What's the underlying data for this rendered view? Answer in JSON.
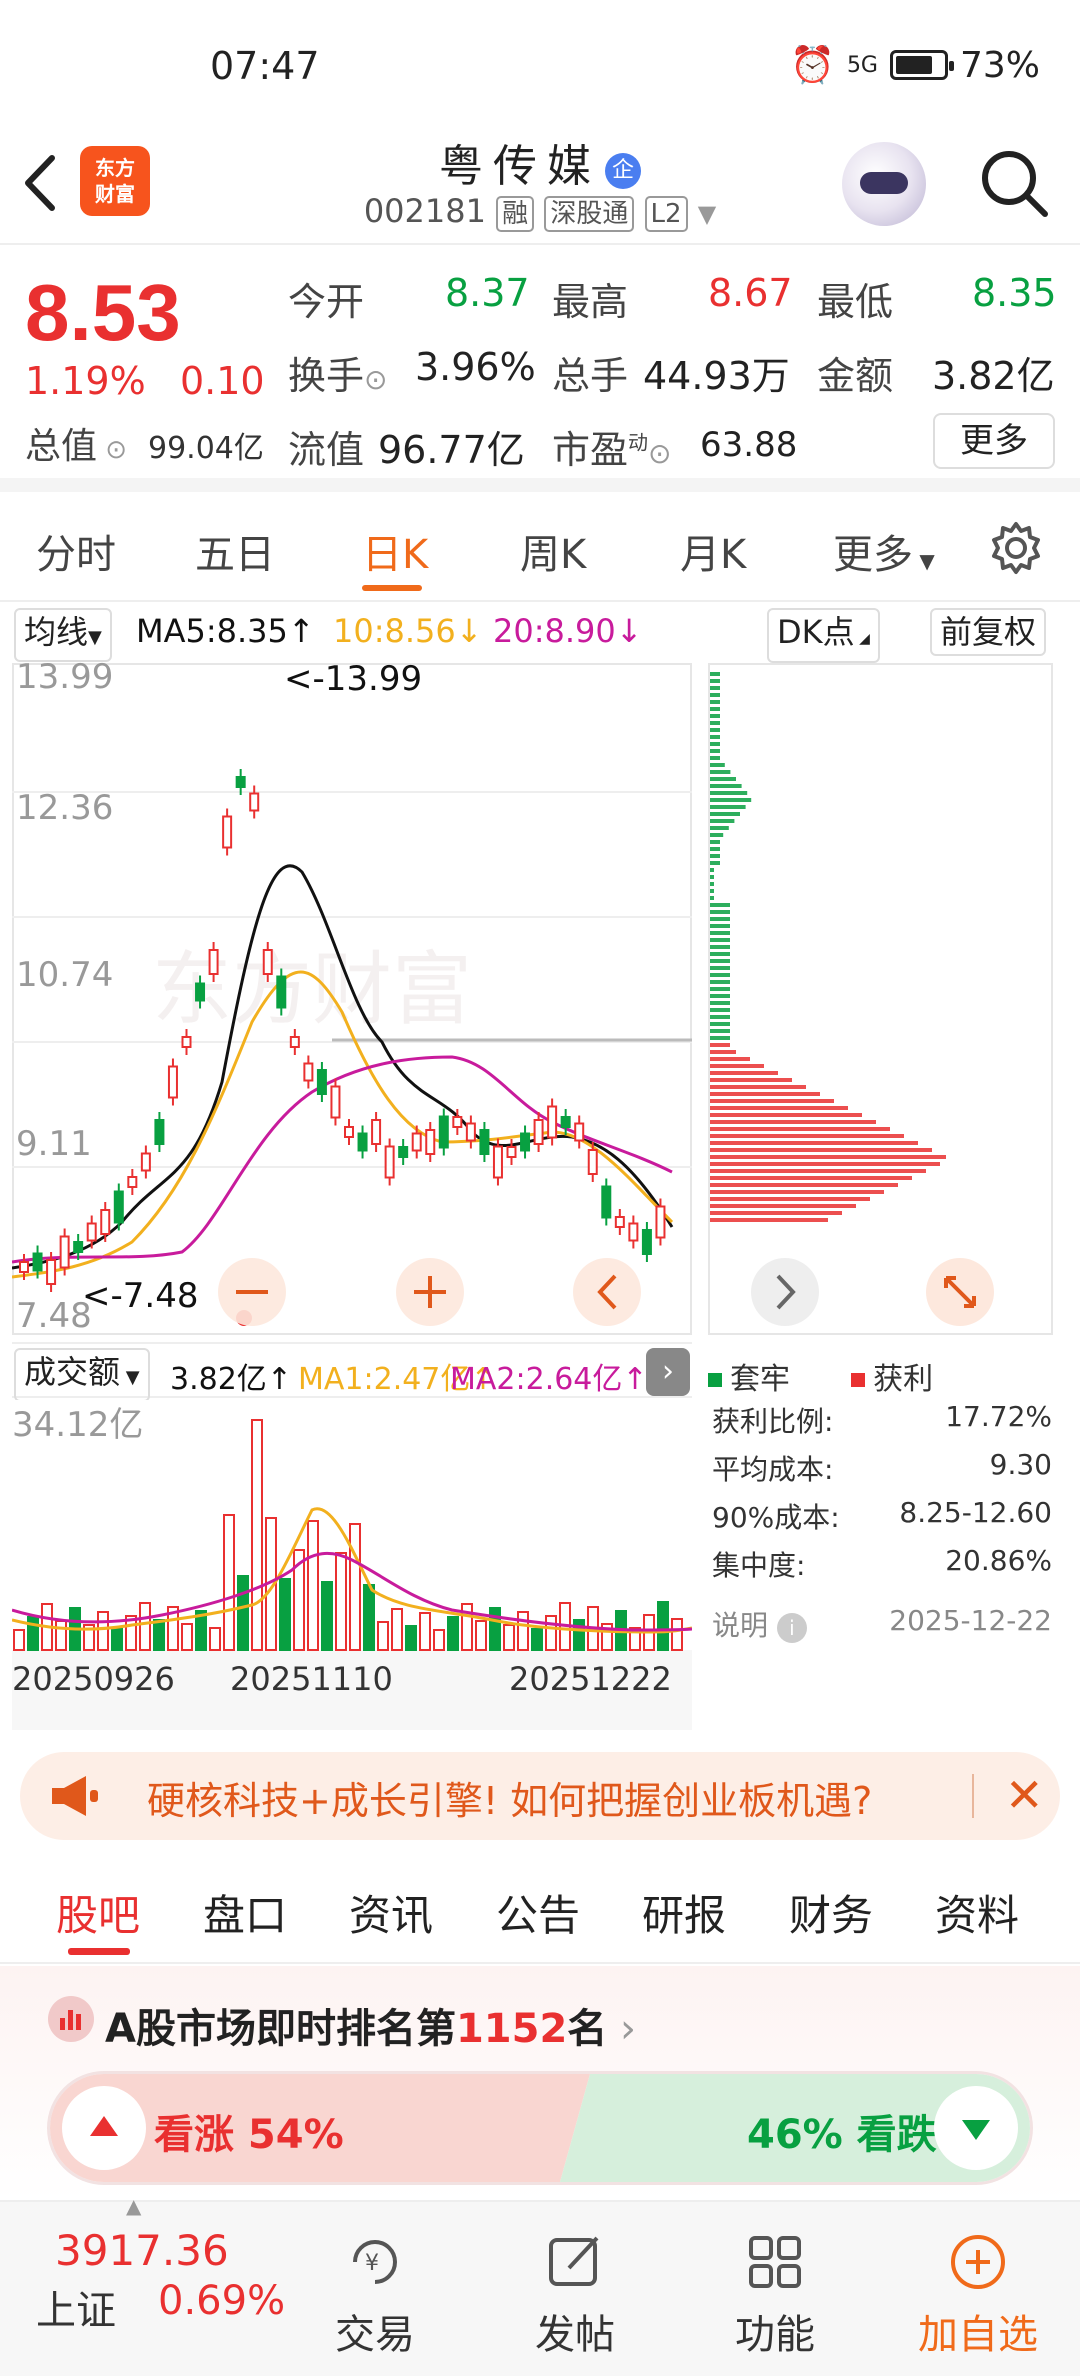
{
  "status_bar": {
    "time": "07:47",
    "network": "5G",
    "battery": "73%"
  },
  "header": {
    "logo_line1": "东方",
    "logo_line2": "财富",
    "stock_name": "粤传媒",
    "badge": "企",
    "code": "002181",
    "tags": [
      "融",
      "深股通",
      "L2"
    ]
  },
  "quote": {
    "price": "8.53",
    "change_pct": "1.19%",
    "change": "0.10",
    "open_label": "今开",
    "open": "8.37",
    "high_label": "最高",
    "high": "8.67",
    "low_label": "最低",
    "low": "8.35",
    "turnover_label": "换手",
    "turnover": "3.96%",
    "volume_label": "总手",
    "volume": "44.93万",
    "amount_label": "金额",
    "amount": "3.82亿",
    "total_cap_label": "总值",
    "total_cap": "99.04亿",
    "float_cap_label": "流值",
    "float_cap": "96.77亿",
    "pe_label": "市盈",
    "pe_sup": "动",
    "pe": "63.88",
    "more_label": "更多"
  },
  "kline_tabs": [
    "分时",
    "五日",
    "日K",
    "周K",
    "月K",
    "更多"
  ],
  "kline_active": "日K",
  "indicators": {
    "ma_selector": "均线",
    "ma5": "MA5:8.35↑",
    "ma10": "10:8.56↓",
    "ma20": "20:8.90↓",
    "dk_label": "DK点",
    "adjust_label": "前复权"
  },
  "price_chart": {
    "y_ticks": [
      "13.99",
      "12.36",
      "10.74",
      "9.11",
      "7.48"
    ],
    "max_label": "<-13.99",
    "min_label": "<-7.48",
    "watermark": "东方财富"
  },
  "volume_header": {
    "selector": "成交额",
    "value": "3.82亿↑",
    "ma1": "MA1:2.47亿↑",
    "ma2": "MA2:2.64亿↑"
  },
  "volume_chart": {
    "y_max_label": "34.12亿",
    "x_labels": [
      "20250926",
      "20251110",
      "20251222"
    ]
  },
  "cost_profile": {
    "legend_trapped": "套牢",
    "legend_profit": "获利",
    "stats": [
      {
        "label": "获利比例:",
        "value": "17.72%"
      },
      {
        "label": "平均成本:",
        "value": "9.30"
      },
      {
        "label": "90%成本:",
        "value": "8.25-12.60"
      },
      {
        "label": "集中度:",
        "value": "20.86%"
      }
    ],
    "note_label": "说明",
    "date": "2025-12-22"
  },
  "banner": {
    "text": "硬核科技+成长引擎! 如何把握创业板机遇?"
  },
  "info_tabs": [
    "股吧",
    "盘口",
    "资讯",
    "公告",
    "研报",
    "财务",
    "资料"
  ],
  "info_active": "股吧",
  "rank": {
    "prefix": "A股市场即时排名第",
    "number": "1152",
    "suffix": "名"
  },
  "vote": {
    "up_label": "看涨 54%",
    "down_label": "46% 看跌",
    "up_pct": 54
  },
  "footer": {
    "index_value": "3917.36",
    "index_name": "上证",
    "index_change": "0.69%",
    "trade": "交易",
    "post": "发帖",
    "functions": "功能",
    "add_watch": "加自选"
  },
  "colors": {
    "up": "#e93030",
    "down": "#08a041",
    "accent": "#f06a1a",
    "ma5": "#111111",
    "ma10": "#f2b01e",
    "ma20": "#c81b9c"
  }
}
